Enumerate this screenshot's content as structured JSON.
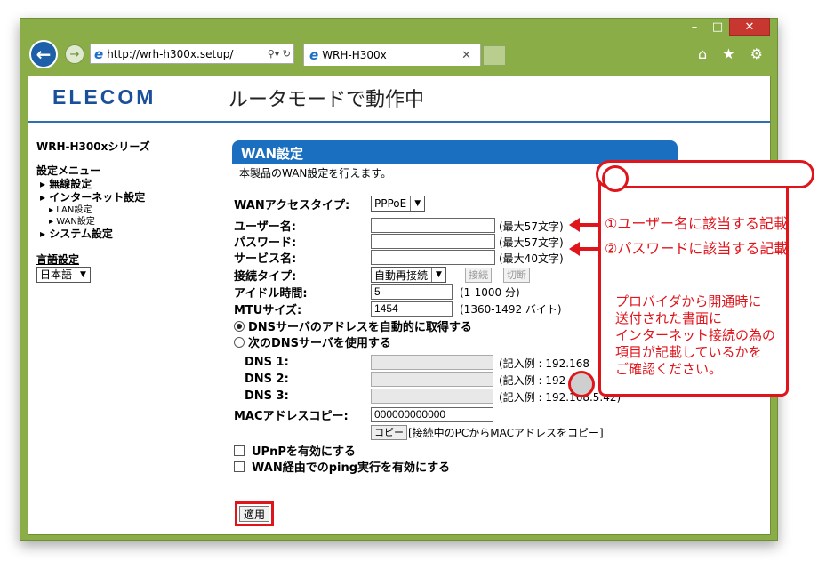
{
  "window": {
    "url": "http://wrh-h300x.setup/",
    "tab_title": "WRH-H300x",
    "minimize": "–",
    "maximize": "□",
    "close": "✕",
    "right_icons": "⌂ ★ ⚙"
  },
  "header": {
    "logo": "ELECOM",
    "mode": "ルータモードで動作中"
  },
  "sidebar": {
    "product": "WRH-H300xシリーズ",
    "menu_title": "設定メニュー",
    "items": [
      "▸ 無線設定",
      "▸ インターネット設定",
      "▸ LAN設定",
      "▸ WAN設定",
      "▸ システム設定"
    ],
    "lang_title": "言語設定",
    "lang_value": "日本語"
  },
  "wan": {
    "title": "WAN設定",
    "description": "本製品のWAN設定を行えます。",
    "access_type_label": "WANアクセスタイプ:",
    "access_type_value": "PPPoE",
    "username_label": "ユーザー名:",
    "username_hint": "(最大57文字)",
    "password_label": "パスワード:",
    "password_hint": "(最大57文字)",
    "service_label": "サービス名:",
    "service_hint": "(最大40文字)",
    "conn_type_label": "接続タイプ:",
    "conn_type_value": "自動再接続",
    "connect_btn": "接続",
    "disconnect_btn": "切断",
    "idle_label": "アイドル時間:",
    "idle_value": "5",
    "idle_hint": "(1-1000 分)",
    "mtu_label": "MTUサイズ:",
    "mtu_value": "1454",
    "mtu_hint": "(1360-1492 バイト)",
    "dns_auto": "DNSサーバのアドレスを自動的に取得する",
    "dns_manual": "次のDNSサーバを使用する",
    "dns1_label": "DNS 1:",
    "dns1_hint": "(記入例 : 192.168",
    "dns2_label": "DNS 2:",
    "dns2_hint": "(記入例 : 192",
    "dns3_label": "DNS 3:",
    "dns3_hint": "(記入例 : 192.168.5.42)",
    "mac_label": "MACアドレスコピー:",
    "mac_value": "000000000000",
    "copy_btn": "コピー",
    "copy_hint": "[接続中のPCからMACアドレスをコピー]",
    "upnp": "UPnPを有効にする",
    "ping": "WAN経由でのping実行を有効にする",
    "apply": "適用"
  },
  "annotations": {
    "note1": "①ユーザー名に該当する記載",
    "note2": "②パスワードに該当する記載",
    "callout": [
      "プロバイダから開通時に",
      "送付された書面に",
      "インターネット接続の為の",
      "項目が記載しているかを",
      "ご確認ください。"
    ],
    "accent_color": "#e0151c"
  }
}
